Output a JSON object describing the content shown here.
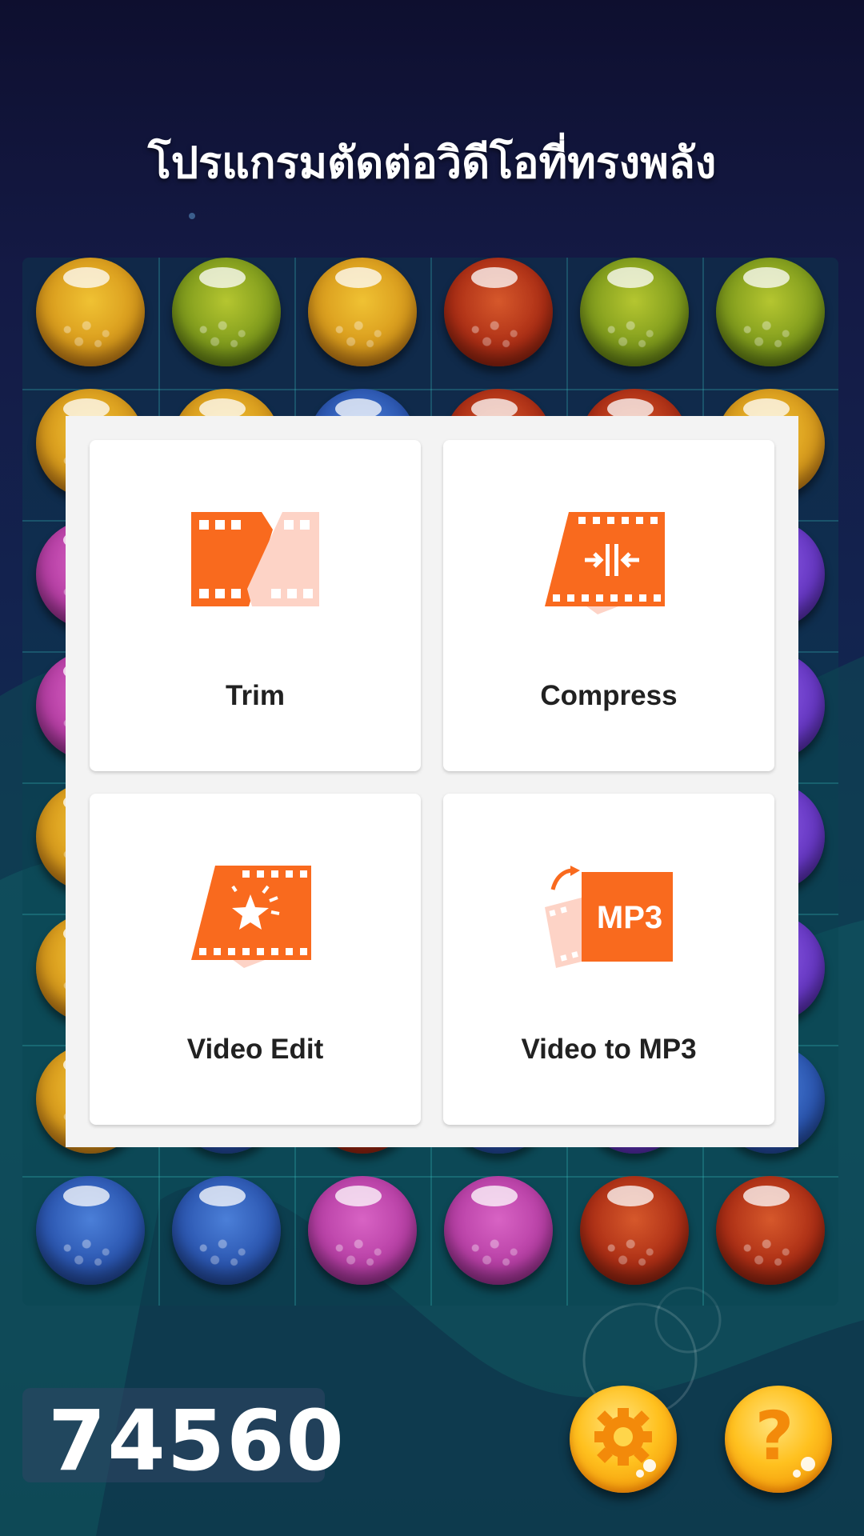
{
  "title": "โปรแกรมตัดต่อวิดีโอที่ทรงพลัง",
  "score": "74560",
  "colors": {
    "accent": "#F96A1E",
    "accent_light": "#FDD3C6",
    "button_yellow": "#FFC11F",
    "dialog_bg": "#F3F3F3"
  },
  "board": {
    "rows": 8,
    "cols": 6,
    "marbles": [
      [
        "yellow",
        "green",
        "yellow",
        "red",
        "green",
        "green"
      ],
      [
        "yellow",
        "yellow",
        "blue",
        "red",
        "red",
        "yellow"
      ],
      [
        "magenta",
        "",
        "",
        "",
        "",
        "purple"
      ],
      [
        "magenta",
        "",
        "",
        "",
        "",
        "purple"
      ],
      [
        "yellow",
        "",
        "",
        "",
        "",
        "purple"
      ],
      [
        "yellow",
        "",
        "",
        "",
        "",
        "purple"
      ],
      [
        "yellow",
        "blue",
        "red",
        "blue",
        "purple",
        "blue"
      ],
      [
        "blue",
        "blue",
        "magenta",
        "magenta",
        "red",
        "red"
      ]
    ]
  },
  "menu": {
    "items": [
      {
        "label": "Trim",
        "icon": "trim-film-icon"
      },
      {
        "label": "Compress",
        "icon": "compress-film-icon"
      },
      {
        "label": "Video Edit",
        "icon": "video-edit-star-icon"
      },
      {
        "label": "Video to MP3",
        "icon": "mp3-convert-icon",
        "badge": "MP3"
      }
    ]
  },
  "buttons": {
    "settings": {
      "icon": "gear-icon"
    },
    "help": {
      "icon": "question-mark-icon",
      "glyph": "?"
    }
  }
}
